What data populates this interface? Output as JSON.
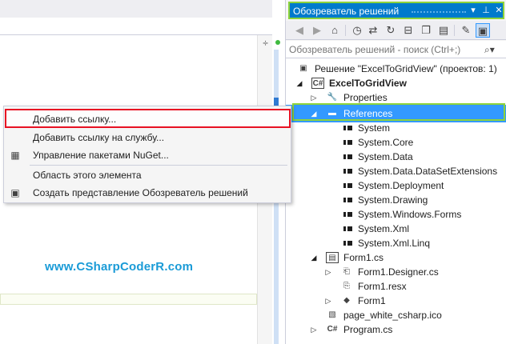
{
  "watermark": "www.CSharpCoderR.com",
  "context_menu": {
    "items": [
      {
        "label": "Добавить ссылку...",
        "icon": "none"
      },
      {
        "label": "Добавить ссылку на службу...",
        "icon": "none"
      },
      {
        "label": "Управление пакетами NuGet...",
        "icon": "nuget-package-icon"
      },
      {
        "label": "Область этого элемента",
        "icon": "none"
      },
      {
        "label": "Создать представление Обозреватель решений",
        "icon": "new-view-icon"
      }
    ]
  },
  "solution_explorer": {
    "title": "Обозреватель решений",
    "search_placeholder": "Обозреватель решений - поиск (Ctrl+;)",
    "tree": {
      "solution": "Решение \"ExcelToGridView\"  (проектов: 1)",
      "project": "ExcelToGridView",
      "properties": "Properties",
      "references": "References",
      "reference_items": [
        "System",
        "System.Core",
        "System.Data",
        "System.Data.DataSetExtensions",
        "System.Deployment",
        "System.Drawing",
        "System.Windows.Forms",
        "System.Xml",
        "System.Xml.Linq"
      ],
      "form1_cs": "Form1.cs",
      "form1_designer": "Form1.Designer.cs",
      "form1_resx": "Form1.resx",
      "form1": "Form1",
      "ico": "page_white_csharp.ico",
      "program": "Program.cs"
    }
  },
  "colors": {
    "accent": "#007acc",
    "highlight_frame": "#8dd33a",
    "context_highlight": "#e81123",
    "selection": "#3399ff",
    "watermark": "#1a9bd7"
  }
}
